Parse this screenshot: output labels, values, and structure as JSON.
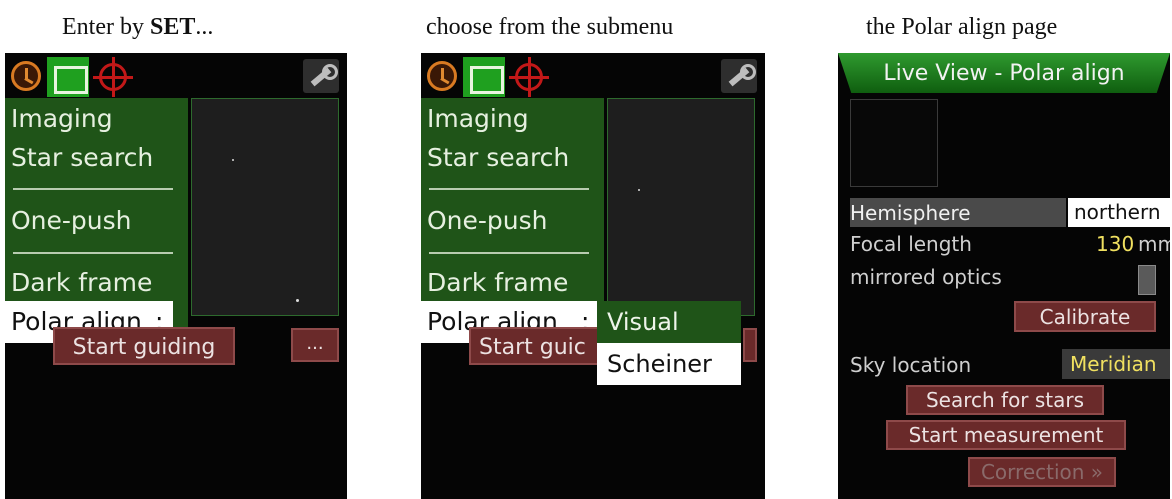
{
  "captions": {
    "step1_prefix": "Enter by ",
    "step1_bold": "SET",
    "step1_suffix": "...",
    "step2": "choose from the submenu",
    "step3": "the Polar align page"
  },
  "menu": {
    "items": [
      "Imaging",
      "Star search",
      "One-push",
      "Dark frame"
    ],
    "selected_label": "Polar align",
    "selected_suffix": ":"
  },
  "buttons": {
    "start_guiding": "Start guiding",
    "start_guiding_partial": "Start guic",
    "more": "..."
  },
  "submenu": {
    "items": [
      "Visual",
      "Scheiner"
    ]
  },
  "polar_page": {
    "title": "Live View - Polar align",
    "hemisphere_label": "Hemisphere",
    "hemisphere_value": "northern",
    "focal_length_label": "Focal length",
    "focal_length_value": "130",
    "focal_length_unit": "mm",
    "mirrored_label": "mirrored optics",
    "calibrate": "Calibrate",
    "sky_location_label": "Sky location",
    "sky_location_value": "Meridian",
    "search_stars": "Search for stars",
    "start_measurement": "Start measurement",
    "correction": "Correction »"
  },
  "colors": {
    "menu_green": "#1f5418",
    "active_tab_green": "#1fa01f",
    "button_red": "#6a2a2a",
    "value_yellow": "#f0e060"
  },
  "icons": [
    "clock-icon",
    "frame-icon",
    "target-icon",
    "wrench-icon"
  ]
}
